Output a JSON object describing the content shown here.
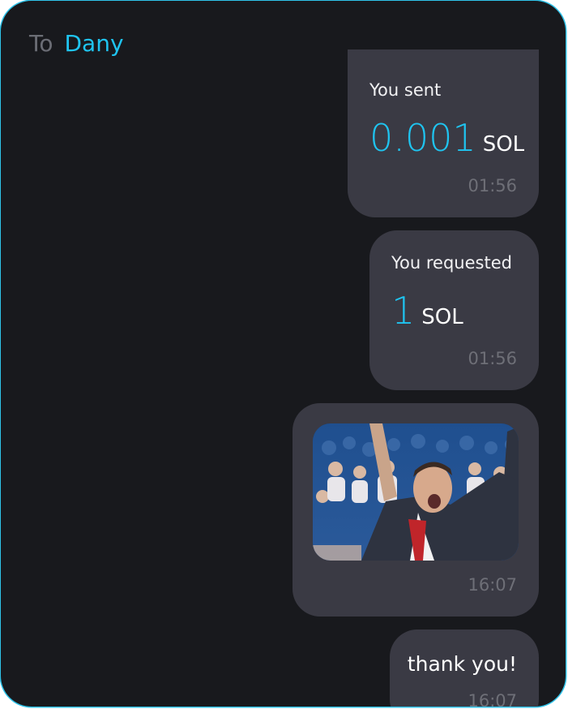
{
  "header": {
    "to_label": "To",
    "recipient": "Dany"
  },
  "messages": [
    {
      "type": "payment",
      "caption": "You sent",
      "amount": "0.001",
      "currency": "SOL",
      "time": "01:56"
    },
    {
      "type": "request",
      "caption": "You requested",
      "amount": "1",
      "currency": "SOL",
      "time": "01:56"
    },
    {
      "type": "image",
      "image_description": "celebrating-tennis-player-gif",
      "time": "16:07"
    },
    {
      "type": "text",
      "text": "thank you!",
      "time": "16:07"
    }
  ],
  "colors": {
    "background": "#18191d",
    "bubble": "#3a3a44",
    "accent": "#1fc4f0",
    "muted": "#6e6f77"
  }
}
